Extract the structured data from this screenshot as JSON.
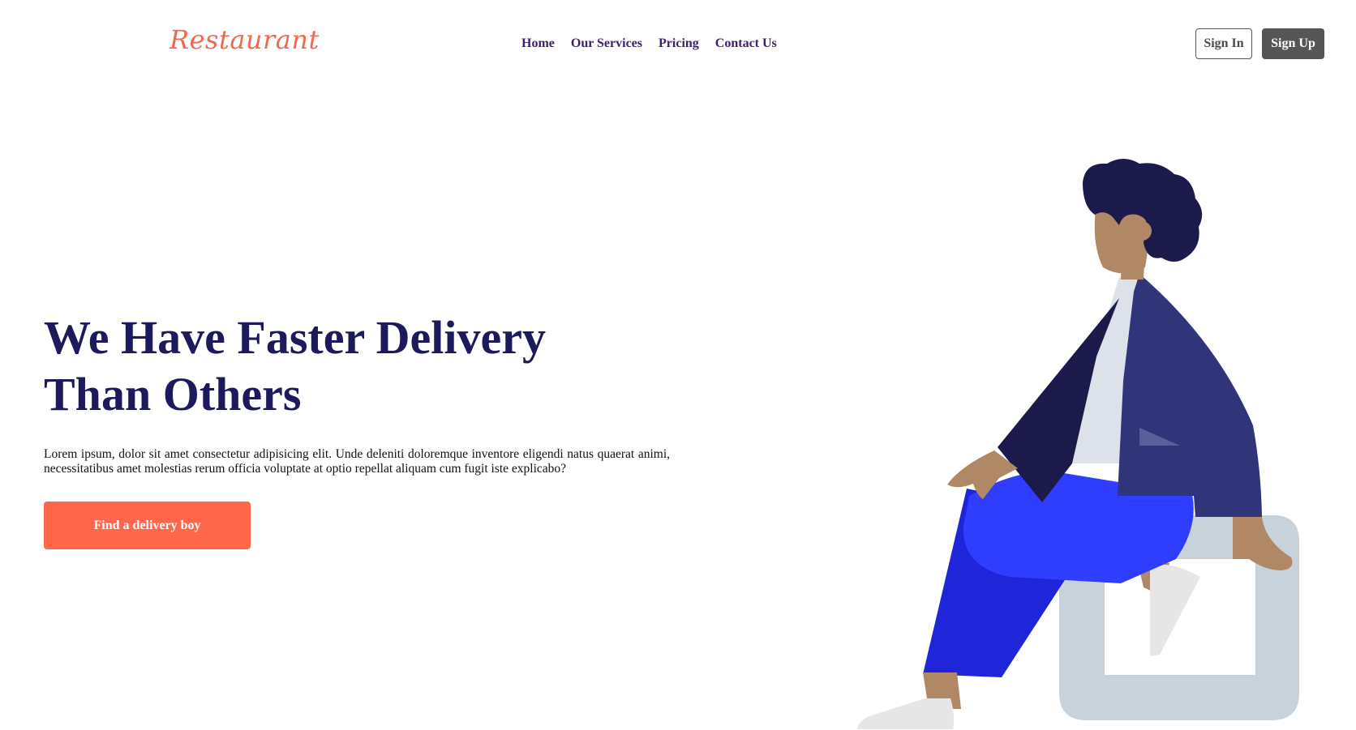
{
  "header": {
    "logo_text": "Restaurant",
    "nav_items": [
      {
        "label": "Home"
      },
      {
        "label": "Our Services"
      },
      {
        "label": "Pricing"
      },
      {
        "label": "Contact Us"
      }
    ],
    "sign_in_label": "Sign In",
    "sign_up_label": "Sign Up"
  },
  "hero": {
    "title_line1": "We Have Faster Delivery",
    "title_line2": "Than Others",
    "description": "Lorem ipsum, dolor sit amet consectetur adipisicing elit. Unde deleniti doloremque inventore eligendi natus quaerat animi, necessitatibus amet molestias rerum officia voluptate at optio repellat aliquam cum fugit iste explicabo?",
    "cta_label": "Find a delivery boy"
  },
  "colors": {
    "logo": "#ee6a4f",
    "nav_link": "#3d1f6b",
    "title": "#1c1a5c",
    "cta_background": "#ff664a",
    "sign_up_background": "#555555"
  },
  "illustration": {
    "icon": "sitting-person-illustration"
  }
}
